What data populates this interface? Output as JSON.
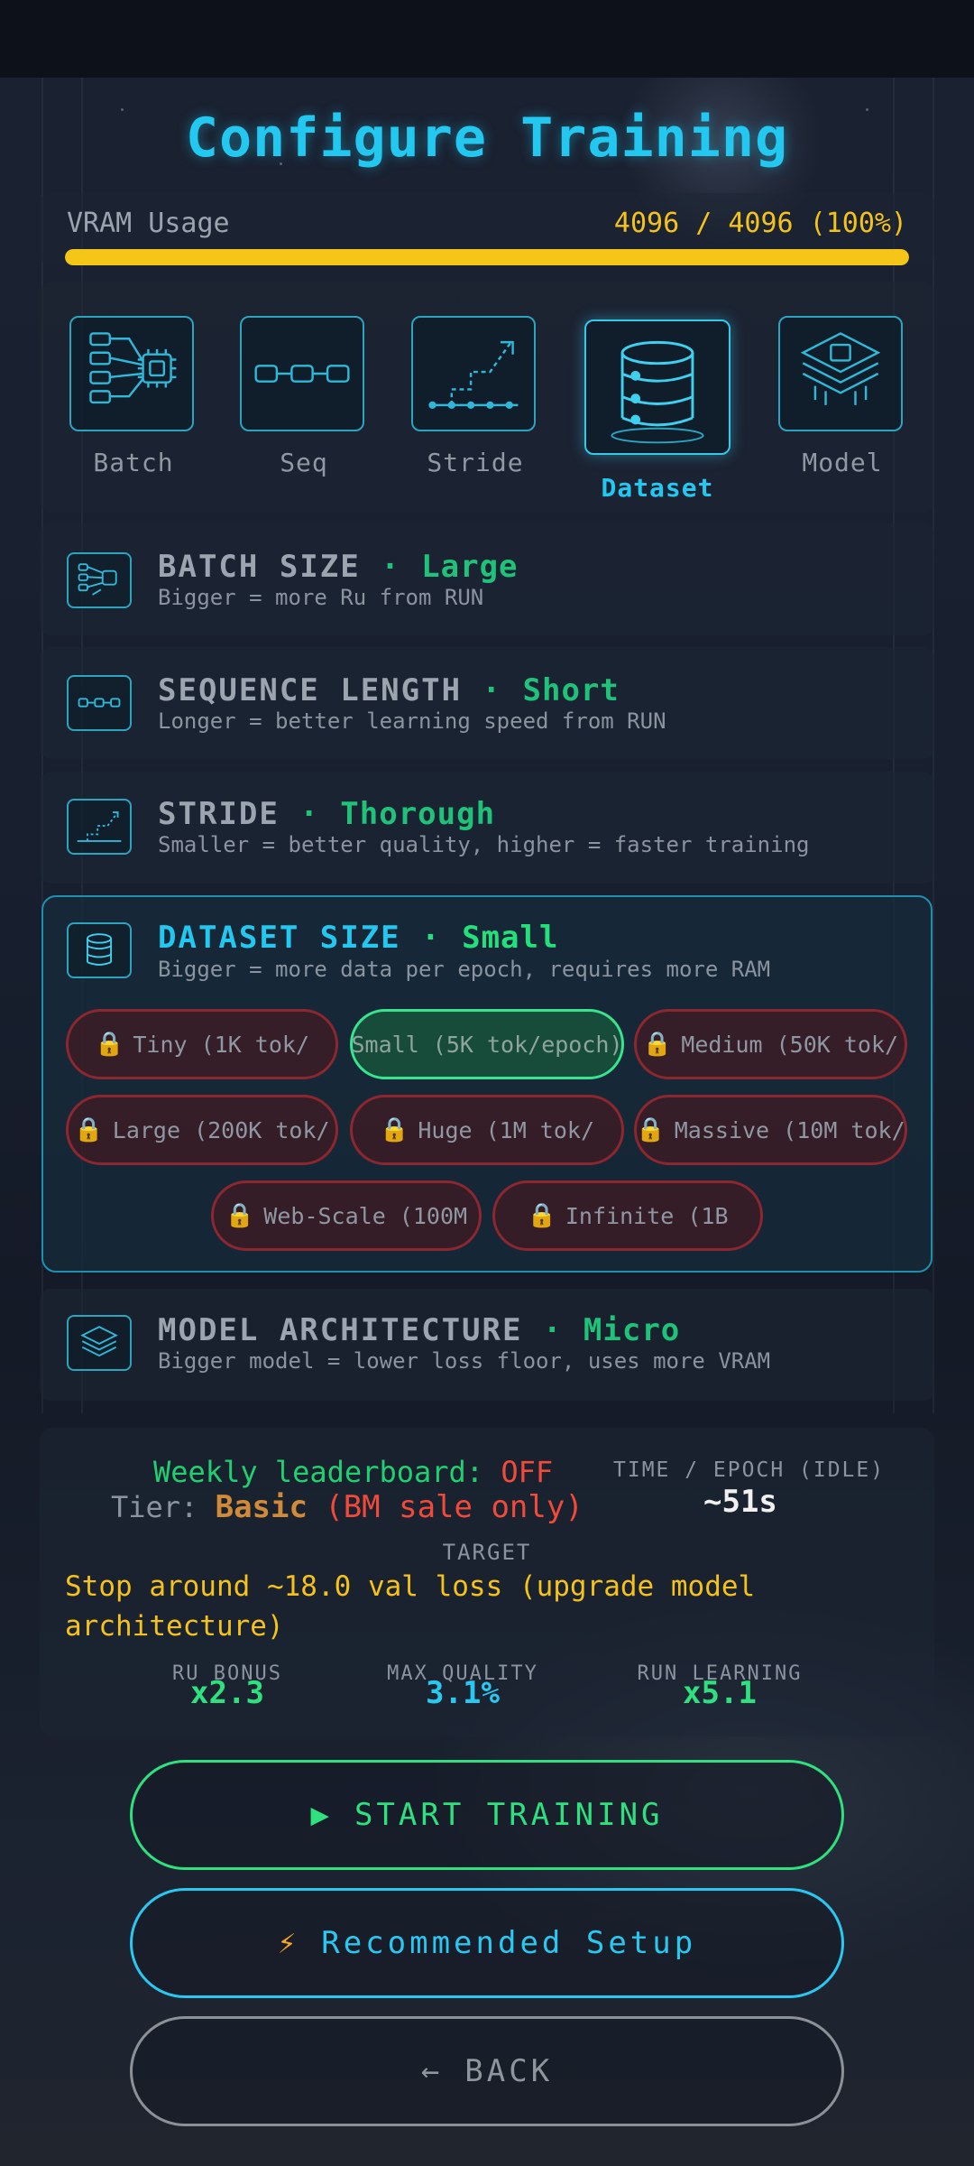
{
  "title": "Configure Training",
  "vram": {
    "label": "VRAM Usage",
    "value": "4096 / 4096 (100%)",
    "fraction": 1.0
  },
  "tabs": [
    {
      "label": "Batch",
      "icon": "batch-chip-icon",
      "active": false
    },
    {
      "label": "Seq",
      "icon": "sequence-chain-icon",
      "active": false
    },
    {
      "label": "Stride",
      "icon": "stride-steps-icon",
      "active": false
    },
    {
      "label": "Dataset",
      "icon": "database-icon",
      "active": true
    },
    {
      "label": "Model",
      "icon": "model-layers-icon",
      "active": false
    }
  ],
  "settings": {
    "batch": {
      "title": "BATCH SIZE",
      "sep": "·",
      "value": "Large",
      "desc": "Bigger = more Ru from RUN"
    },
    "sequence": {
      "title": "SEQUENCE LENGTH",
      "sep": "·",
      "value": "Short",
      "desc": "Longer = better learning speed from RUN"
    },
    "stride": {
      "title": "STRIDE",
      "sep": "·",
      "value": "Thorough",
      "desc": "Smaller = better quality, higher = faster training"
    },
    "dataset": {
      "title": "DATASET SIZE",
      "sep": "·",
      "value": "Small",
      "desc": "Bigger = more data per epoch, requires more RAM",
      "options": [
        {
          "label": "Tiny (1K tok/",
          "locked": true
        },
        {
          "label": "Small (5K tok/epoch)",
          "locked": false,
          "selected": true
        },
        {
          "label": "Medium (50K tok/",
          "locked": true
        },
        {
          "label": "Large (200K tok/",
          "locked": true
        },
        {
          "label": "Huge (1M tok/",
          "locked": true
        },
        {
          "label": "Massive (10M tok/",
          "locked": true
        },
        {
          "label": "Web-Scale (100M",
          "locked": true
        },
        {
          "label": "Infinite (1B",
          "locked": true
        }
      ]
    },
    "model": {
      "title": "MODEL ARCHITECTURE",
      "sep": "·",
      "value": "Micro",
      "desc": "Bigger model = lower loss floor, uses more VRAM"
    }
  },
  "stats": {
    "leaderboard_label": "Weekly leaderboard:",
    "leaderboard_value": "OFF",
    "tier_label": "Tier:",
    "tier_value": "Basic",
    "tier_note": "(BM sale only)",
    "time_label": "TIME / EPOCH (IDLE)",
    "time_value": "~51s",
    "target_label": "TARGET",
    "target_text": "Stop around ~18.0 val loss (upgrade model architecture)",
    "ru_bonus_label": "RU BONUS",
    "ru_bonus_value": "x2.3",
    "max_quality_label": "MAX QUALITY",
    "max_quality_value": "3.1%",
    "run_learning_label": "RUN LEARNING",
    "run_learning_value": "x5.1"
  },
  "buttons": {
    "start": "START TRAINING",
    "start_glyph": "▶",
    "recommended": "Recommended Setup",
    "recommended_glyph": "⚡",
    "back": "BACK",
    "back_glyph": "←"
  },
  "colors": {
    "accent_cyan": "#22c8f0",
    "accent_green": "#20c27a",
    "warning_yellow": "#f5c518",
    "locked_red": "#8c2730"
  }
}
